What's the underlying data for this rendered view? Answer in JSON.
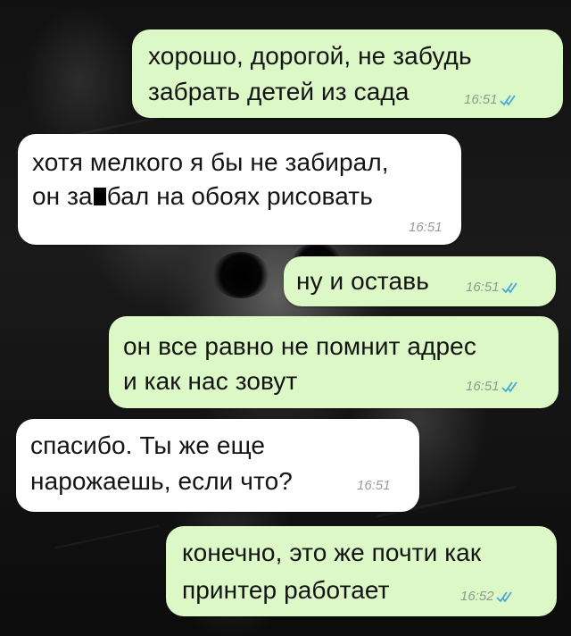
{
  "chat": {
    "messages": [
      {
        "direction": "outgoing",
        "lines": [
          "хорошо, дорогой, не забудь",
          "забрать детей из сада"
        ],
        "time": "16:51",
        "status_icon": "double-check-icon"
      },
      {
        "direction": "incoming",
        "lines": [
          "хотя мелкого я бы не забирал,",
          "он за",
          "бал на обоях рисовать"
        ],
        "redacted": true,
        "time": "16:51"
      },
      {
        "direction": "outgoing",
        "lines": [
          "ну и оставь"
        ],
        "time": "16:51",
        "status_icon": "double-check-icon"
      },
      {
        "direction": "outgoing",
        "lines": [
          "он все равно не помнит адрес",
          "и как нас зовут"
        ],
        "time": "16:51",
        "status_icon": "double-check-icon"
      },
      {
        "direction": "incoming",
        "lines": [
          "спасибо. Ты же еще",
          "нарожаешь, если что?"
        ],
        "time": "16:51"
      },
      {
        "direction": "outgoing",
        "lines": [
          "конечно, это же почти как",
          "принтер работает"
        ],
        "time": "16:52",
        "status_icon": "double-check-icon"
      }
    ]
  },
  "colors": {
    "outgoing_bubble": "#dcf8c6",
    "incoming_bubble": "#ffffff",
    "text": "#141414",
    "meta_outgoing": "#8f9a8a",
    "meta_incoming": "#9a9a9a",
    "check_mark": "#4aa7d6"
  }
}
